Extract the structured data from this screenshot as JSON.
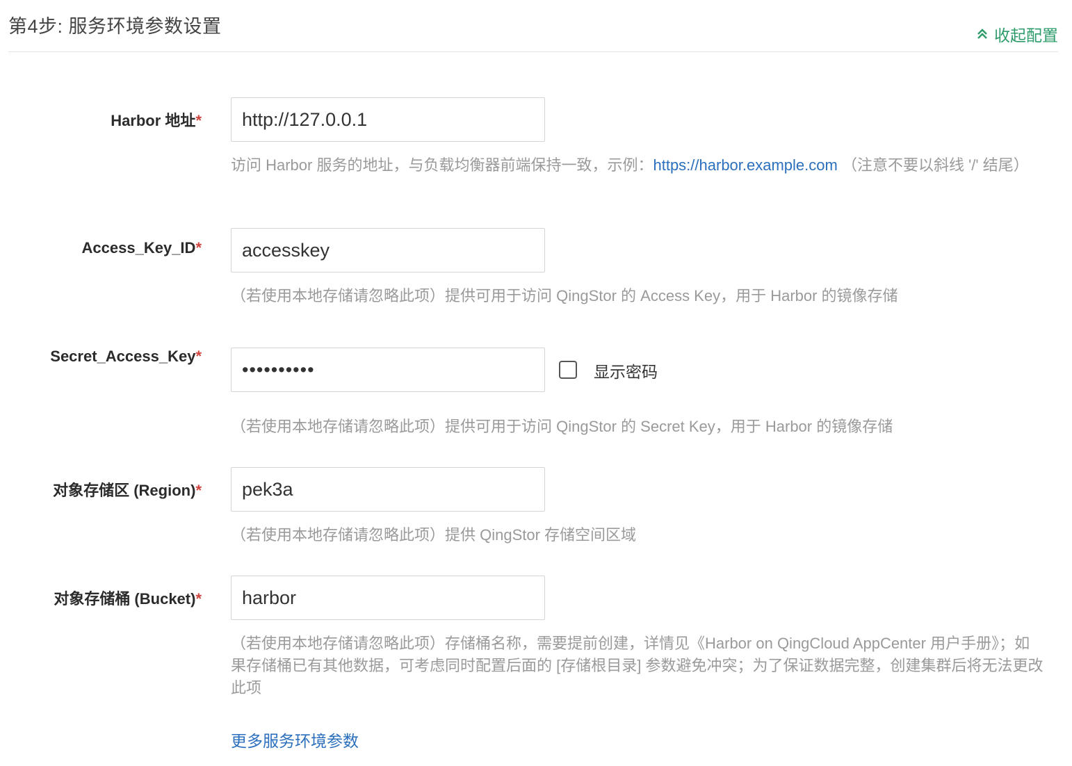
{
  "header": {
    "step_title": "第4步: 服务环境参数设置",
    "collapse_label": "收起配置"
  },
  "fields": [
    {
      "label": "Harbor 地址",
      "required": "*",
      "value": "http://127.0.0.1",
      "help_before": "访问 Harbor 服务的地址，与负载均衡器前端保持一致，示例：",
      "help_link": "https://harbor.example.com",
      "help_after": " （注意不要以斜线 '/' 结尾）"
    },
    {
      "label": "Access_Key_ID",
      "required": "*",
      "value": "accesskey",
      "help": "（若使用本地存储请忽略此项）提供可用于访问 QingStor 的 Access Key，用于 Harbor 的镜像存储"
    },
    {
      "label": "Secret_Access_Key",
      "required": "*",
      "value": "••••••••••",
      "show_password_label": "显示密码",
      "show_password_checked": false,
      "help": "（若使用本地存储请忽略此项）提供可用于访问 QingStor 的 Secret Key，用于 Harbor 的镜像存储"
    },
    {
      "label": "对象存储区 (Region)",
      "required": "*",
      "value": "pek3a",
      "help": "（若使用本地存储请忽略此项）提供 QingStor 存储空间区域"
    },
    {
      "label": "对象存储桶 (Bucket)",
      "required": "*",
      "value": "harbor",
      "help": "（若使用本地存储请忽略此项）存储桶名称，需要提前创建，详情见《Harbor on QingCloud AppCenter 用户手册》；如果存储桶已有其他数据，可考虑同时配置后面的 [存储根目录] 参数避免冲突；为了保证数据完整，创建集群后将无法更改此项"
    }
  ],
  "more_params_label": "更多服务环境参数",
  "colors": {
    "accent_green": "#2e9c6a",
    "link_blue": "#2b6fbd",
    "required_red": "#d0443f",
    "help_gray": "#9a9a9a"
  }
}
